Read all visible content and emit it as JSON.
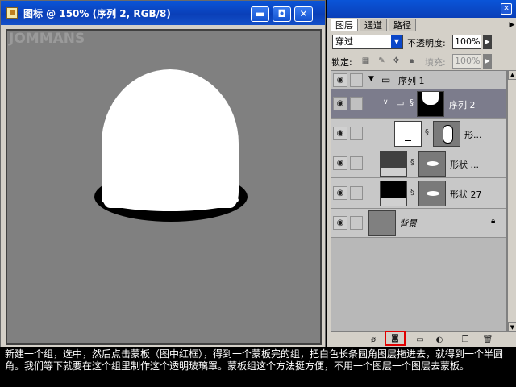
{
  "document": {
    "title": "图标 @ 150% (序列 2, RGB/8)",
    "watermark": "JOMMANS",
    "window_buttons": {
      "minimize": "▬",
      "maximize": "◘",
      "close": "✕"
    }
  },
  "layers_panel": {
    "tabs": [
      "图层",
      "通道",
      "路径"
    ],
    "active_tab": "图层",
    "blend_mode": "穿过",
    "opacity_label": "不透明度:",
    "opacity_value": "100%",
    "lock_label": "锁定:",
    "fill_label": "填充:",
    "fill_value": "100%",
    "layers": [
      {
        "name": "序列 1",
        "type": "group",
        "expanded": true
      },
      {
        "name": "序列 2",
        "type": "group-with-mask",
        "selected": true
      },
      {
        "name": "形...",
        "type": "shape"
      },
      {
        "name": "形状 ...",
        "type": "shape"
      },
      {
        "name": "形状 27",
        "type": "shape"
      },
      {
        "name": "背景",
        "type": "background",
        "locked": true
      }
    ],
    "bottom_buttons": [
      "link-layers",
      "add-layer-mask",
      "new-group",
      "adjustment-layer",
      "new-layer",
      "delete-layer"
    ]
  },
  "caption": "新建一个组，选中，然后点击蒙板（图中红框），得到一个蒙板完的组，把白色长条圆角图层拖进去，就得到一个半圆角。我们等下就要在这个组里制作这个透明玻璃罩。蒙板组这个方法挺方便，不用一个图层一个图层去蒙板。",
  "colors": {
    "titlebar": "#0a46c8",
    "highlight": "#e00000",
    "canvas": "#808080"
  }
}
